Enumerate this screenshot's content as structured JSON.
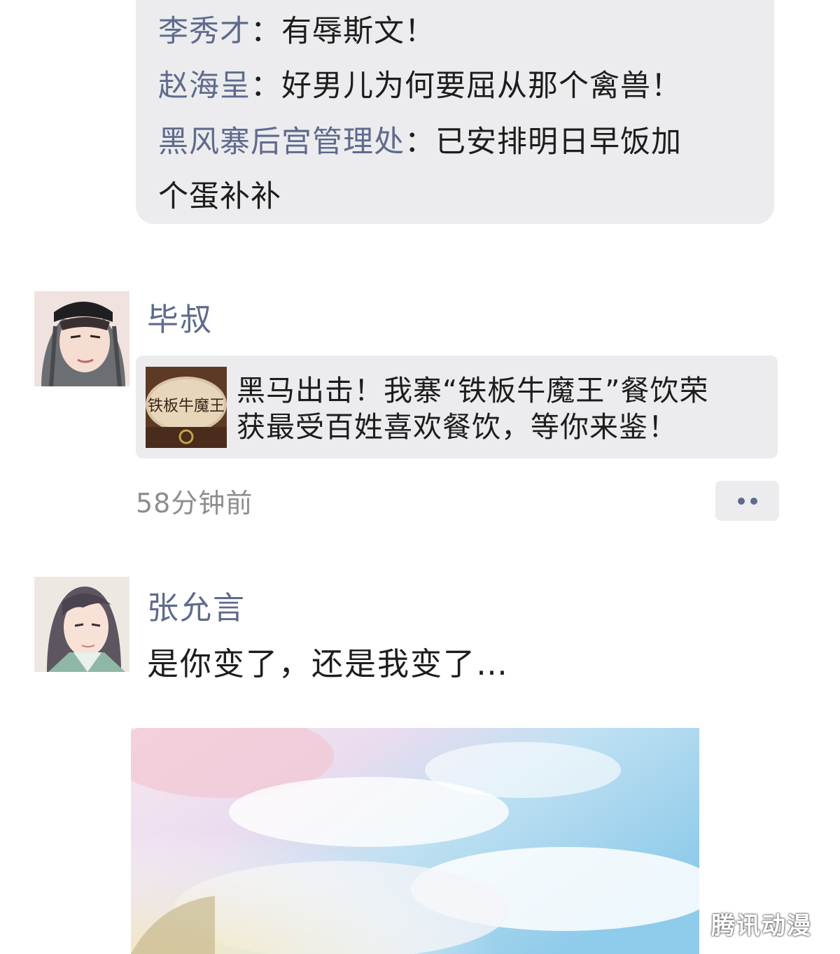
{
  "comments": [
    {
      "name": "李秀才",
      "sep": "：",
      "text": "有辱斯文！"
    },
    {
      "name": "赵海呈",
      "sep": "：",
      "text": "好男儿为何要屈从那个禽兽！"
    },
    {
      "name": "黑风寨后宫管理处",
      "sep": "：",
      "text": "已安排明日早饭加",
      "text2": "个蛋补补"
    }
  ],
  "post1": {
    "author": "毕叔",
    "share_title_line1": "黑马出击！我寨“铁板牛魔王”餐饮荣",
    "share_title_line2": "获最受百姓喜欢餐饮，等你来鉴！",
    "thumb_sign_text": "铁板牛魔王",
    "time": "58分钟前",
    "more_icon": "ellipsis-icon"
  },
  "post2": {
    "author": "张允言",
    "text": "是你变了，还是我变了…"
  },
  "watermark": "腾讯动漫",
  "colors": {
    "name_blue": "#5f6b8c",
    "bubble_gray": "#ececef",
    "text_dark": "#1d1d1d",
    "time_gray": "#8e8e8e"
  }
}
